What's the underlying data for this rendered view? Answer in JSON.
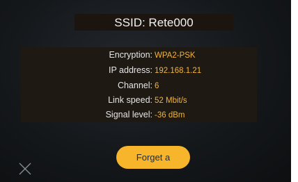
{
  "header": {
    "title": "SSID: Rete000"
  },
  "details": [
    {
      "label": "Encryption:",
      "value": "WPA2-PSK"
    },
    {
      "label": "IP address:",
      "value": "192.168.1.21"
    },
    {
      "label": "Channel:",
      "value": "6"
    },
    {
      "label": "Link speed:",
      "value": "52 Mbit/s"
    },
    {
      "label": "Signal level:",
      "value": "-36 dBm"
    }
  ],
  "actions": {
    "forget_label": "Forget a"
  },
  "icons": {
    "close": "close-icon"
  },
  "colors": {
    "accent": "#f6b52a",
    "value_text": "#f3b539",
    "background": "#15181b"
  }
}
